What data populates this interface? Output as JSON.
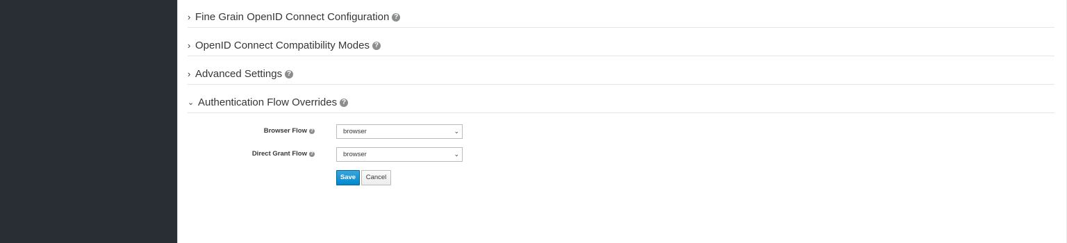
{
  "sections": [
    {
      "title": "Fine Grain OpenID Connect Configuration",
      "expanded": false,
      "chevron": "chevron-right-icon",
      "help_icon": "question-circle-icon"
    },
    {
      "title": "OpenID Connect Compatibility Modes",
      "expanded": false,
      "chevron": "chevron-right-icon",
      "help_icon": "question-circle-icon"
    },
    {
      "title": "Advanced Settings",
      "expanded": false,
      "chevron": "chevron-right-icon",
      "help_icon": "question-circle-icon"
    },
    {
      "title": "Authentication Flow Overrides",
      "expanded": true,
      "chevron": "chevron-down-icon",
      "help_icon": "question-circle-icon"
    }
  ],
  "form": {
    "browser_flow": {
      "label": "Browser Flow",
      "value": "browser"
    },
    "direct_grant_flow": {
      "label": "Direct Grant Flow",
      "value": "browser"
    }
  },
  "actions": {
    "save_label": "Save",
    "cancel_label": "Cancel"
  },
  "colors": {
    "sidebar": "#292e34",
    "primary_button": "#0088ce",
    "text": "#363636",
    "help_icon": "#8b8d8f"
  },
  "glyphs": {
    "chevron_right": "›",
    "chevron_down": "⌄",
    "help": "?",
    "select_caret": "⌄"
  }
}
